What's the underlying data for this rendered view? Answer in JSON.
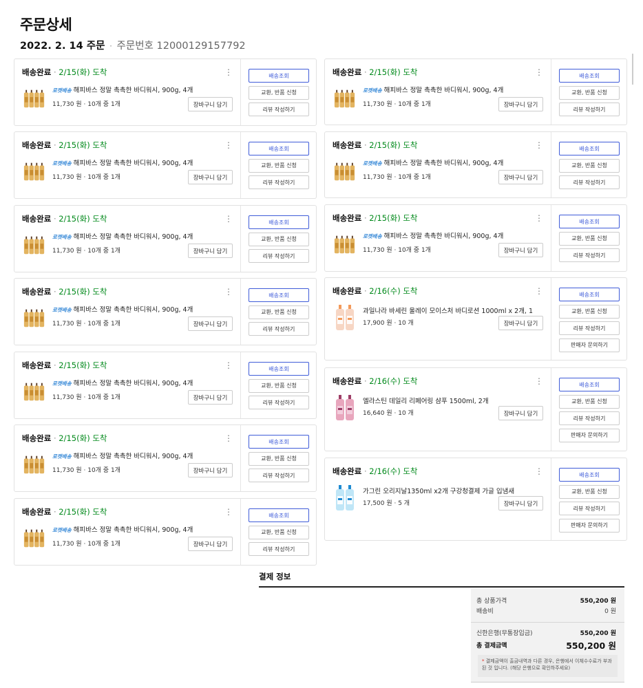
{
  "page": {
    "title": "주문상세",
    "order_date": "2022. 2. 14 주문",
    "separator": "·",
    "order_no_label": "주문번호",
    "order_no": "12000129157792"
  },
  "buttons": {
    "track": "배송조회",
    "exchange": "교환, 반품 신청",
    "review": "리뷰 작성하기",
    "seller": "판매자 문의하기",
    "cart": "장바구니 담기"
  },
  "left_items": [
    {
      "status": "배송완료",
      "dot": "·",
      "arrival": "2/15(화) 도착",
      "badge": "로켓배송",
      "name": "해피바스 정말 촉촉한 바디워시, 900g, 4개",
      "price": "11,730 원 · 10개 중 1개"
    },
    {
      "status": "배송완료",
      "dot": "·",
      "arrival": "2/15(화) 도착",
      "badge": "로켓배송",
      "name": "해피바스 정말 촉촉한 바디워시, 900g, 4개",
      "price": "11,730 원 · 10개 중 1개"
    },
    {
      "status": "배송완료",
      "dot": "·",
      "arrival": "2/15(화) 도착",
      "badge": "로켓배송",
      "name": "해피바스 정말 촉촉한 바디워시, 900g, 4개",
      "price": "11,730 원 · 10개 중 1개"
    },
    {
      "status": "배송완료",
      "dot": "·",
      "arrival": "2/15(화) 도착",
      "badge": "로켓배송",
      "name": "해피바스 정말 촉촉한 바디워시, 900g, 4개",
      "price": "11,730 원 · 10개 중 1개"
    },
    {
      "status": "배송완료",
      "dot": "·",
      "arrival": "2/15(화) 도착",
      "badge": "로켓배송",
      "name": "해피바스 정말 촉촉한 바디워시, 900g, 4개",
      "price": "11,730 원 · 10개 중 1개"
    },
    {
      "status": "배송완료",
      "dot": "·",
      "arrival": "2/15(화) 도착",
      "badge": "로켓배송",
      "name": "해피바스 정말 촉촉한 바디워시, 900g, 4개",
      "price": "11,730 원 · 10개 중 1개"
    },
    {
      "status": "배송완료",
      "dot": "·",
      "arrival": "2/15(화) 도착",
      "badge": "로켓배송",
      "name": "해피바스 정말 촉촉한 바디워시, 900g, 4개",
      "price": "11,730 원 · 10개 중 1개"
    }
  ],
  "right_items": [
    {
      "status": "배송완료",
      "dot": "·",
      "arrival": "2/15(화) 도착",
      "badge": "로켓배송",
      "name": "해피바스 정말 촉촉한 바디워시, 900g, 4개",
      "price": "11,730 원 · 10개 중 1개"
    },
    {
      "status": "배송완료",
      "dot": "·",
      "arrival": "2/15(화) 도착",
      "badge": "로켓배송",
      "name": "해피바스 정말 촉촉한 바디워시, 900g, 4개",
      "price": "11,730 원 · 10개 중 1개"
    },
    {
      "status": "배송완료",
      "dot": "·",
      "arrival": "2/15(화) 도착",
      "badge": "로켓배송",
      "name": "해피바스 정말 촉촉한 바디워시, 900g, 4개",
      "price": "11,730 원 · 10개 중 1개"
    },
    {
      "status": "배송완료",
      "dot": "·",
      "arrival": "2/16(수) 도착",
      "name": "과일나라 바세린 울레이 모이스처 바디로션 1000ml x 2개, 1",
      "price": "17,900 원 · 10 개"
    },
    {
      "status": "배송완료",
      "dot": "·",
      "arrival": "2/16(수) 도착",
      "name": "엘라스틴 데일리 리페어링 샴푸 1500ml, 2개",
      "price": "16,640 원 · 10 개"
    },
    {
      "status": "배송완료",
      "dot": "·",
      "arrival": "2/16(수) 도착",
      "name": "가그린 오리지날1350ml x2개 구강청결제 가글 입냄새",
      "price": "17,500 원 · 5 개"
    }
  ],
  "payment": {
    "title": "결제 정보",
    "product_total_label": "총 상품가격",
    "product_total": "550,200 원",
    "shipping_label": "배송비",
    "shipping": "0 원",
    "method_label": "신한은행(무통장입금)",
    "method_amount": "550,200 원",
    "grand_total_label": "총 결제금액",
    "grand_total": "550,200 원",
    "notice_star": "*",
    "notice": "결제금액이 출금내역과 다른 경우, 은행에서 이체수수료가 부과된 것 입니다. (해당 은행으로 확인하주세요)"
  },
  "colors": {
    "accent_blue": "#3e5bd8",
    "arrival_green": "#00891a",
    "rocket_blue": "#3a8bd8"
  }
}
